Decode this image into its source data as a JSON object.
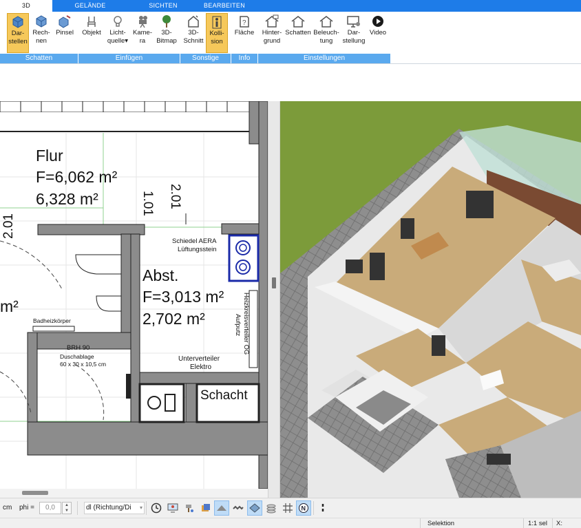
{
  "tabs": [
    {
      "label": "3D",
      "active": true
    },
    {
      "label": "GELÄNDE",
      "active": false
    },
    {
      "label": "SICHTEN",
      "active": false
    },
    {
      "label": "BEARBEITEN",
      "active": false
    }
  ],
  "ribbon": {
    "buttons": [
      {
        "line1": "Dar-",
        "line2": "stellen",
        "icon": "cube-display-icon",
        "active": true
      },
      {
        "line1": "Rech-",
        "line2": "nen",
        "icon": "cube-render-icon",
        "active": false
      },
      {
        "line1": "Pinsel",
        "line2": "",
        "icon": "cube-brush-icon",
        "active": false
      },
      {
        "line1": "Objekt",
        "line2": "",
        "icon": "chair-icon",
        "active": false
      },
      {
        "line1": "Licht-",
        "line2": "quelle",
        "icon": "lightbulb-icon",
        "active": false
      },
      {
        "line1": "Kame-",
        "line2": "ra",
        "icon": "camera-icon",
        "active": false
      },
      {
        "line1": "3D-",
        "line2": "Bitmap",
        "icon": "tree-icon",
        "active": false
      },
      {
        "line1": "3D-",
        "line2": "Schnitt",
        "icon": "section-house-icon",
        "active": false
      },
      {
        "line1": "Kolli-",
        "line2": "sion",
        "icon": "person-collision-icon",
        "active": true
      },
      {
        "line1": "Fläche",
        "line2": "",
        "icon": "area-info-icon",
        "active": false
      },
      {
        "line1": "Hinter-",
        "line2": "grund",
        "icon": "house-background-icon",
        "active": false
      },
      {
        "line1": "Schatten",
        "line2": "",
        "icon": "house-shadow-icon",
        "active": false
      },
      {
        "line1": "Beleuch-",
        "line2": "tung",
        "icon": "house-light-icon",
        "active": false
      },
      {
        "line1": "Dar-",
        "line2": "stellung",
        "icon": "monitor-gear-icon",
        "active": false
      },
      {
        "line1": "Video",
        "line2": "",
        "icon": "play-icon",
        "active": false
      }
    ],
    "groups": [
      "Schatten",
      "Einfügen",
      "Sonstige",
      "Info",
      "Einstellungen"
    ]
  },
  "plan": {
    "rooms": {
      "flur_name": "Flur",
      "flur_area1": "F=6,062 m²",
      "flur_area2": "6,328 m²",
      "abst_name": "Abst.",
      "abst_area1": "F=3,013 m²",
      "abst_area2": "2,702 m²",
      "bath_partial": "m²",
      "schacht": "Schacht"
    },
    "dims": {
      "d1": "1.01",
      "d2": "2.01",
      "d3": "2.01"
    },
    "labels": {
      "schiedel1": "Schiedel AERA",
      "schiedel2": "Lüftungsstein",
      "heizk1": "Heizkreisverteiler OG",
      "heizk2": "Aufputz",
      "unterverteiler1": "Unterverteiler",
      "unterverteiler2": "Elektro",
      "badheiz": "Badheizkörper",
      "brh": "BRH 90",
      "dusch1": "Duschablage",
      "dusch2": "60 x 30 x 10,5 cm"
    }
  },
  "toolbar": {
    "unit": "cm",
    "phi_label": "phi =",
    "phi_value": "0,0",
    "combo": "dl (Richtung/Di",
    "icons": [
      "clock-icon",
      "monitor-person-icon",
      "paint-icon",
      "layers-icon",
      "ramp-icon",
      "wave-icon",
      "diamond-icon",
      "stack-icon",
      "grid-icon",
      "north-icon",
      "pin-icon"
    ]
  },
  "status": {
    "mode": "Selektion",
    "scale": "1:1 sel",
    "x_label": "X:"
  },
  "colors": {
    "ribbon_blue": "#1e7ce8",
    "group_blue": "#5aa9ee",
    "active_orange": "#f6c85a",
    "grass": "#7c9b3a"
  }
}
